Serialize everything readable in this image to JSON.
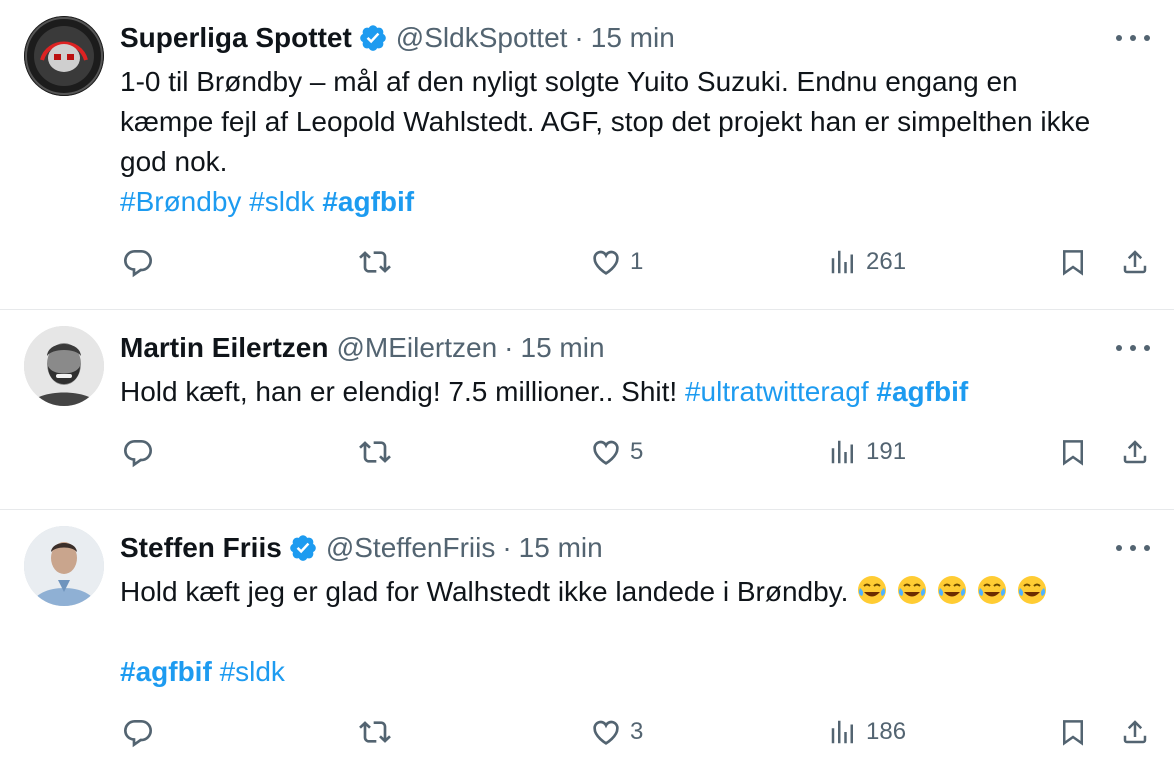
{
  "tweets": [
    {
      "name": "Superliga Spottet",
      "verified": true,
      "handle": "@SldkSpottet",
      "separator": "·",
      "time": "15 min",
      "text": "1-0 til Brøndby – mål af den nyligt solgte Yuito Suzuki. Endnu engang en kæmpe fejl af Leopold Wahlstedt. AGF, stop det projekt han er simpelthen ikke god nok.",
      "tags": [
        "#Brøndby",
        "#sldk",
        "#agfbif"
      ],
      "likes": "1",
      "views": "261"
    },
    {
      "name": "Martin Eilertzen",
      "verified": false,
      "handle": "@MEilertzen",
      "separator": "·",
      "time": "15 min",
      "text": "Hold kæft, han er elendig! 7.5 millioner.. Shit!",
      "tags": [
        "#ultratwitteragf",
        "#agfbif"
      ],
      "likes": "5",
      "views": "191"
    },
    {
      "name": "Steffen Friis",
      "verified": true,
      "handle": "@SteffenFriis",
      "separator": "·",
      "time": "15 min",
      "text": "Hold kæft jeg er glad for Walhstedt ikke landede i Brøndby.",
      "emoji_name": "face-with-tears-of-joy-icon",
      "emoji_count": 5,
      "tags": [
        "#agfbif",
        "#sldk"
      ],
      "likes": "3",
      "views": "186"
    }
  ],
  "colors": {
    "text": "#0f1419",
    "secondary": "#536471",
    "link": "#1d9bf0",
    "divider": "#e7e9eb"
  }
}
